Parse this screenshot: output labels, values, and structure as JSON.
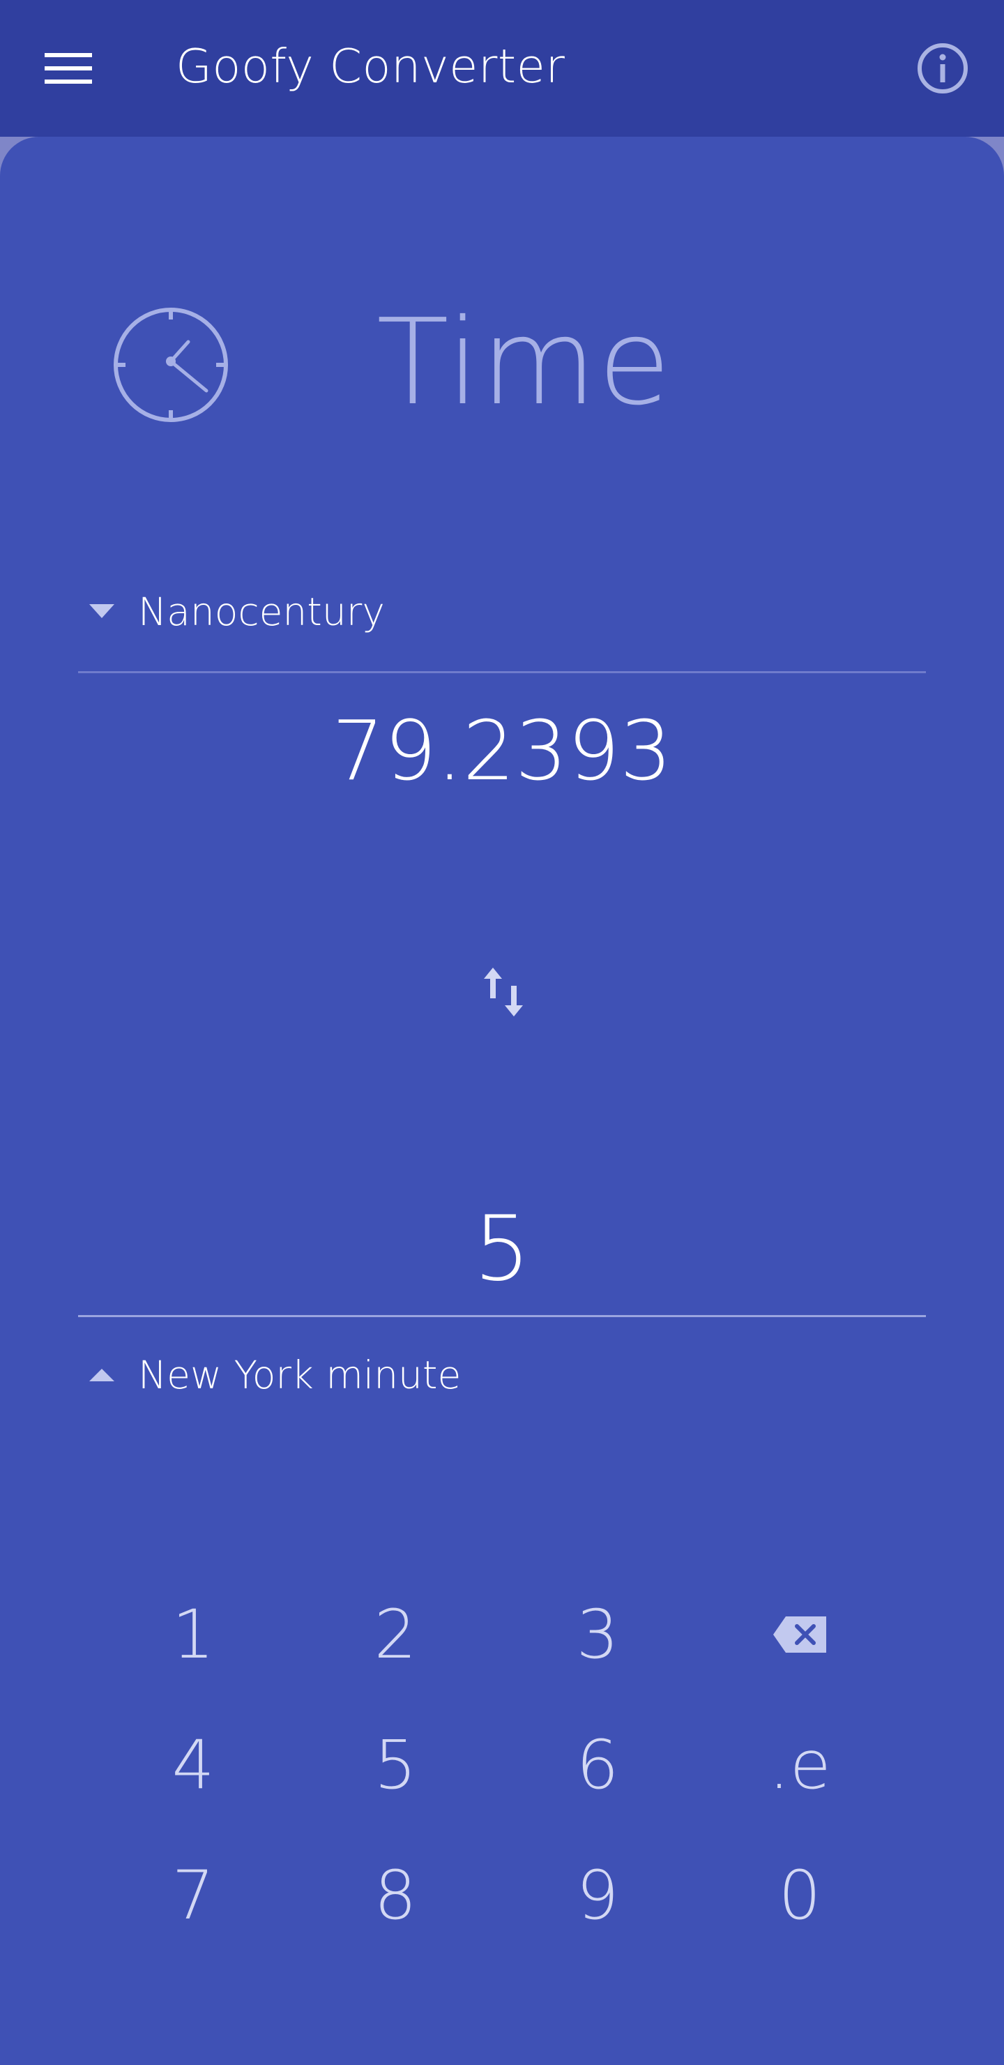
{
  "app": {
    "title": "Goofy Converter",
    "menu_icon": "hamburger-menu-icon",
    "info_icon": "info-icon"
  },
  "category": {
    "icon": "clock-icon",
    "title": "Time"
  },
  "from": {
    "unit": "Nanocentury",
    "value": "79.2393",
    "dropdown_icon": "triangle-down-icon"
  },
  "swap": {
    "icon": "swap-vertical-icon"
  },
  "to": {
    "unit": "New York minute",
    "value": "5",
    "dropdown_icon": "triangle-up-icon"
  },
  "keypad": {
    "keys": [
      "1",
      "2",
      "3",
      "",
      "4",
      "5",
      "6",
      ".e",
      "7",
      "8",
      "9",
      "0"
    ],
    "backspace_icon": "backspace-icon"
  },
  "colors": {
    "appbar": "#303f9f",
    "background": "#3f51b5",
    "title_muted": "#a6b0e6"
  }
}
